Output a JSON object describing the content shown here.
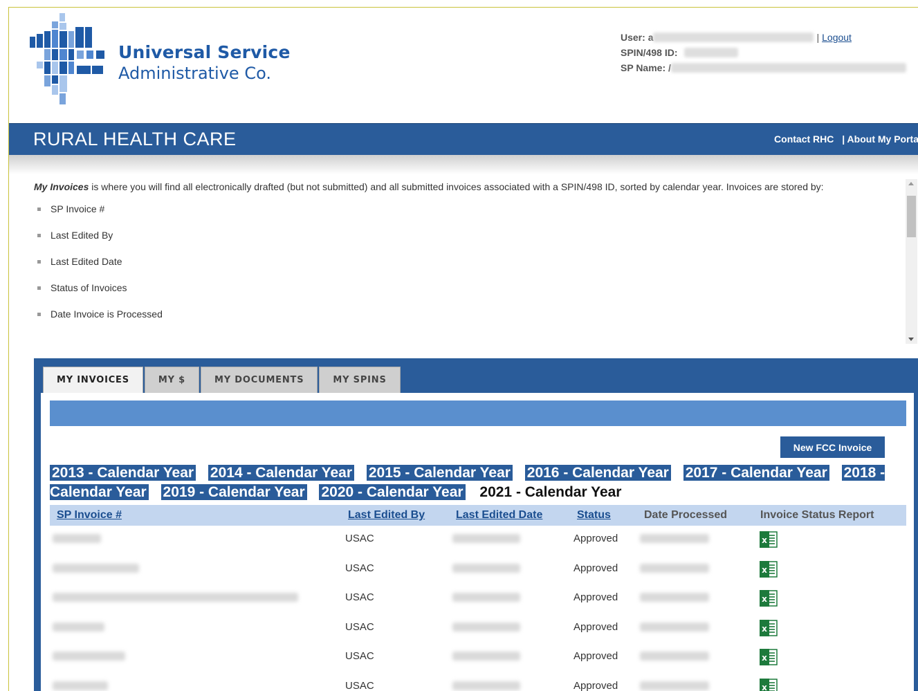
{
  "header": {
    "logo_line1": "Universal Service",
    "logo_line2": "Administrative Co.",
    "user_label": "User:",
    "user_value_initial": "a",
    "logout_sep": "|",
    "logout_label": "Logout",
    "spin_label": "SPIN/498 ID:",
    "sp_name_label": "SP Name:",
    "sp_name_initial": "/"
  },
  "banner": {
    "title": "RURAL HEALTH CARE",
    "contact_label": "Contact RHC",
    "about_label": "| About My Porta"
  },
  "intro": {
    "emphasis": "My Invoices",
    "text": " is where you will find all electronically drafted (but not submitted) and all submitted invoices associated with a SPIN/498 ID, sorted by calendar year. Invoices are stored by:",
    "items": [
      "SP Invoice #",
      "Last Edited By",
      "Last Edited Date",
      "Status of Invoices",
      "Date Invoice is Processed"
    ]
  },
  "tabs": [
    {
      "label": "MY INVOICES",
      "active": true
    },
    {
      "label": "MY $",
      "active": false
    },
    {
      "label": "MY DOCUMENTS",
      "active": false
    },
    {
      "label": "MY SPINS",
      "active": false
    }
  ],
  "new_invoice_label": "New FCC Invoice",
  "years": [
    "2013 - Calendar Year",
    "2014 - Calendar Year",
    "2015 - Calendar Year",
    "2016 - Calendar Year",
    "2017 - Calendar Year",
    "2018 - Calendar Year",
    "2019 - Calendar Year",
    "2020 - Calendar Year",
    "2021 - Calendar Year"
  ],
  "table": {
    "columns": [
      "SP Invoice #",
      "Last Edited By",
      "Last Edited Date",
      "Status",
      "Date Processed",
      "Invoice Status Report"
    ],
    "rows": [
      {
        "edited_by": "USAC",
        "status": "Approved"
      },
      {
        "edited_by": "USAC",
        "status": "Approved"
      },
      {
        "edited_by": "USAC",
        "status": "Approved"
      },
      {
        "edited_by": "USAC",
        "status": "Approved"
      },
      {
        "edited_by": "USAC",
        "status": "Approved"
      },
      {
        "edited_by": "USAC",
        "status": "Approved"
      }
    ]
  },
  "colors": {
    "brand_blue": "#2a5c9a",
    "bar_blue": "#5a8fce",
    "header_row": "#c3d6ef",
    "excel_green": "#1d7a3c"
  }
}
